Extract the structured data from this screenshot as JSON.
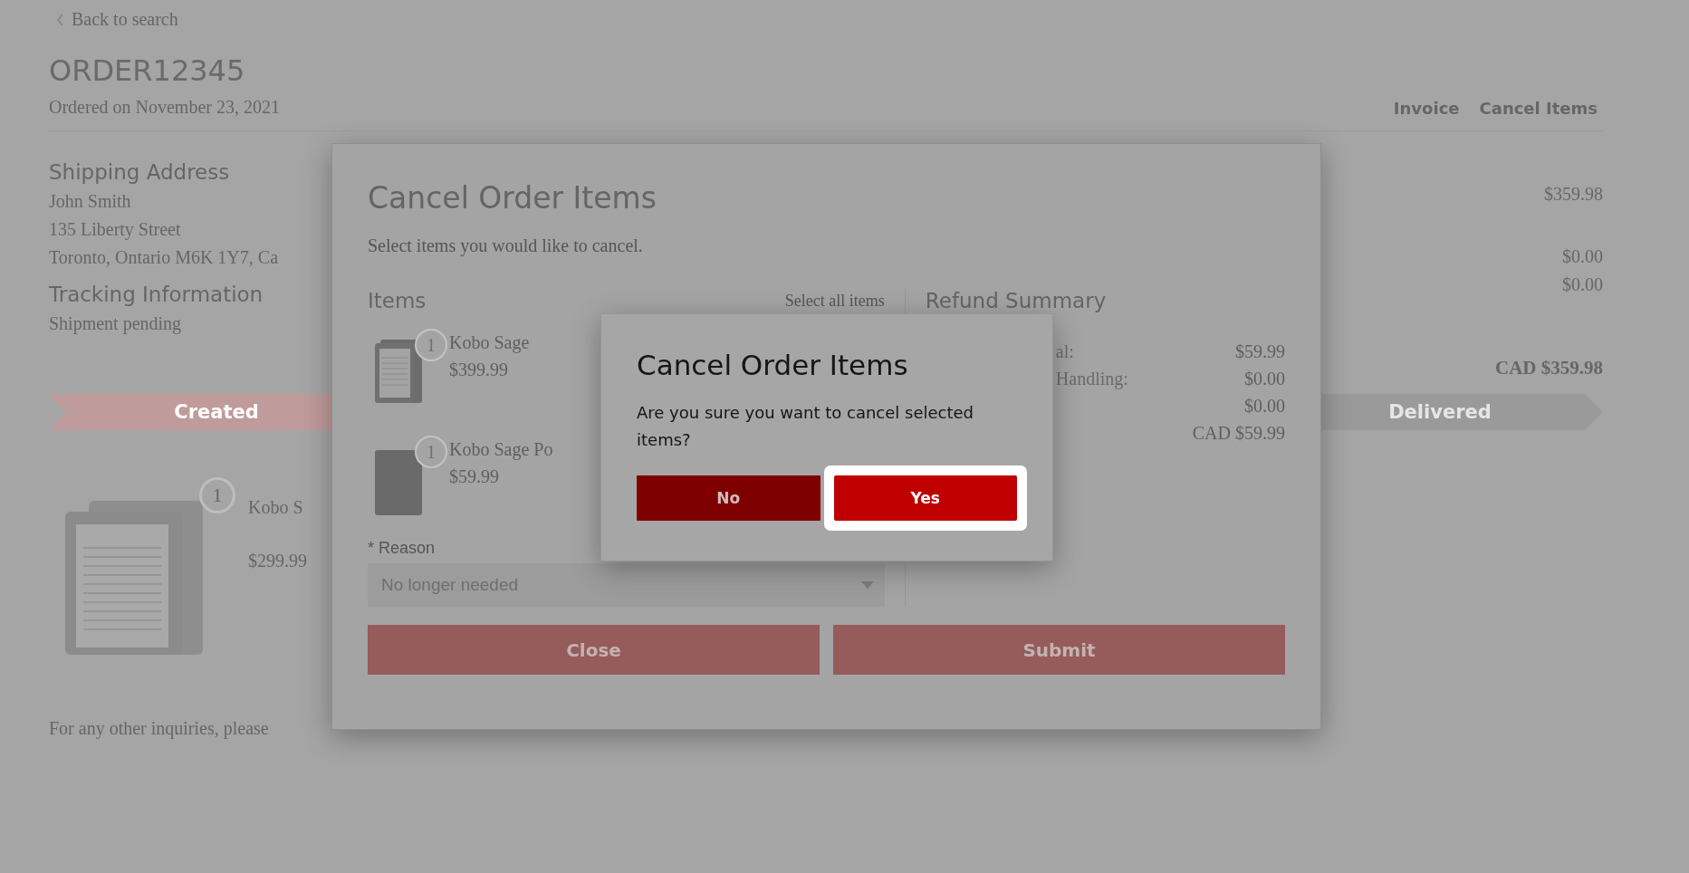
{
  "page": {
    "back_link": "Back to search",
    "order_number": "ORDER12345",
    "ordered_on": "Ordered on November 23, 2021",
    "actions": [
      "Invoice",
      "Cancel Items"
    ],
    "shipping": {
      "heading": "Shipping Address",
      "lines": [
        "John Smith",
        "135 Liberty Street",
        "Toronto, Ontario M6K 1Y7, Ca"
      ]
    },
    "tracking": {
      "heading": "Tracking Information",
      "status": "Shipment pending"
    },
    "amounts": [
      "$359.98",
      "$0.00",
      "$0.00"
    ],
    "total": "CAD $359.98",
    "steps": [
      {
        "label": "Created",
        "reached": true
      },
      {
        "label": "Delivered",
        "reached": false
      }
    ],
    "item": {
      "quantity": "1",
      "name": "Kobo S",
      "price": "$299.99"
    },
    "footer": "For any other inquiries, please"
  },
  "modal": {
    "title": "Cancel Order Items",
    "subtitle": "Select items you would like to cancel.",
    "items_heading": "Items",
    "select_all": "Select all items",
    "items": [
      {
        "quantity": "1",
        "name": "Kobo Sage",
        "price": "$399.99",
        "kind": "ereader"
      },
      {
        "quantity": "1",
        "name": "Kobo Sage Po",
        "price": "$59.99",
        "kind": "cover"
      }
    ],
    "reason_label": "* Reason",
    "reason_value": "No longer needed",
    "refund_heading": "Refund Summary",
    "refund_rows": [
      {
        "label": "al:",
        "value": "$59.99"
      },
      {
        "label": "Handling:",
        "value": "$0.00"
      },
      {
        "value": "$0.00"
      },
      {
        "value": "CAD $59.99"
      }
    ],
    "buttons": [
      "Close",
      "Submit"
    ]
  },
  "confirm": {
    "title": "Cancel Order Items",
    "message": "Are you sure you want to cancel selected items?",
    "buttons": [
      {
        "label": "No",
        "kind": "secondary",
        "focused": false
      },
      {
        "label": "Yes",
        "kind": "primary",
        "focused": true
      }
    ]
  }
}
